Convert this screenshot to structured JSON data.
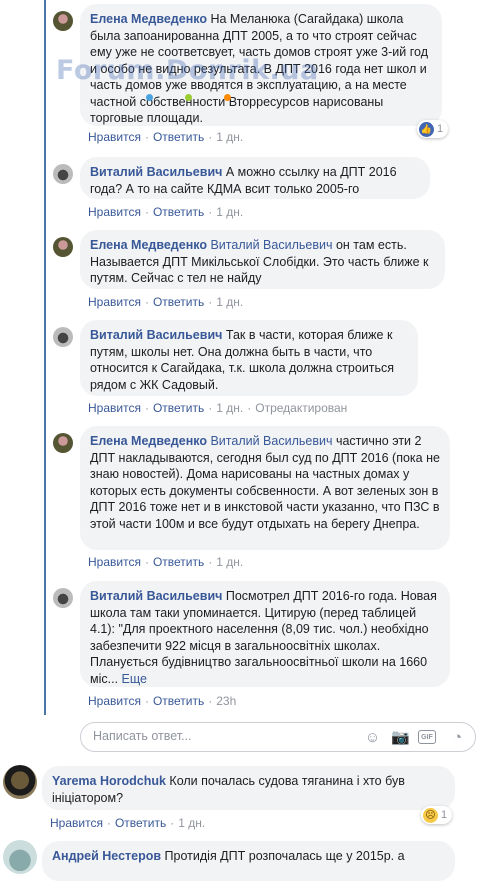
{
  "watermark": "Forum.Donrik.ua",
  "actions": {
    "like": "Нравится",
    "reply": "Ответить"
  },
  "comments": [
    {
      "author": "Елена Медведенко",
      "text": "На Меланюка (Сагайдака) школа была запоанированна ДПТ 2005, а то что строят сейчас ему уже не соответсвует, часть домов строят уже 3-ий год и особо не видно результата. В ДПТ 2016 года нет школ и часть домов уже вводятся в эксплуатацию, а на месте частной собственности Вторресурсов нарисованы торговые площади.",
      "time": "1 дн.",
      "reaction_count": "1"
    },
    {
      "author": "Виталий Васильевич",
      "text": "А можно ссылку на ДПТ 2016 года? А то на сайте КДМА всит только 2005-го",
      "time": "1 дн."
    },
    {
      "author": "Елена Медведенко",
      "mention": "Виталий Васильевич",
      "text": "он там есть. Называется ДПТ Микільської Слобідки. Это часть ближе к путям. Сейчас с тел не найду",
      "time": "1 дн."
    },
    {
      "author": "Виталий Васильевич",
      "text": "Так в части, которая ближе к путям, школы нет. Она должна быть в части, что относится к Сагайдака, т.к. школа должна строиться рядом с ЖК Садовый.",
      "time": "1 дн.",
      "edited": "Отредактирован"
    },
    {
      "author": "Елена Медведенко",
      "mention": "Виталий Васильевич",
      "text": "частично эти 2 ДПТ накладываются, сегодня был суд по ДПТ 2016 (пока не знаю новостей). Дома нарисованы на частных домах у которых есть документы собсвенности. А вот зеленых зон в ДПТ 2016 тоже нет и в инкстовой части указанно, что ПЗС в этой части 100м и все будут отдыхать на берегу Днепра.",
      "time": "1 дн."
    },
    {
      "author": "Виталий Васильевич",
      "text": "Посмотрел ДПТ 2016-го года. Новая школа там таки упоминается. Цитирую (перед таблицей 4.1): \"Для проектного населення (8,09 тис. чол.) необхідно забезпечити 922 місця в загальноосвітніх школах. Планується будівництво загальноосвітньої школи на 1660 міс...",
      "more": "Еще",
      "time": "23h"
    },
    {
      "author": "Yarema Horodchuk",
      "text": "Коли почалась судова тяганина і хто був ініціатором?",
      "time": "1 дн.",
      "reaction_count": "1"
    },
    {
      "author": "Андрей Нестеров",
      "text": "Протидія ДПТ розпочалась ще у 2015р. а"
    }
  ],
  "reply_box": {
    "placeholder": "Написать ответ..."
  },
  "colors": {
    "link": "#385898",
    "bubble": "#f2f3f5",
    "thread_line": "#4a76a8",
    "muted": "#90949c"
  }
}
